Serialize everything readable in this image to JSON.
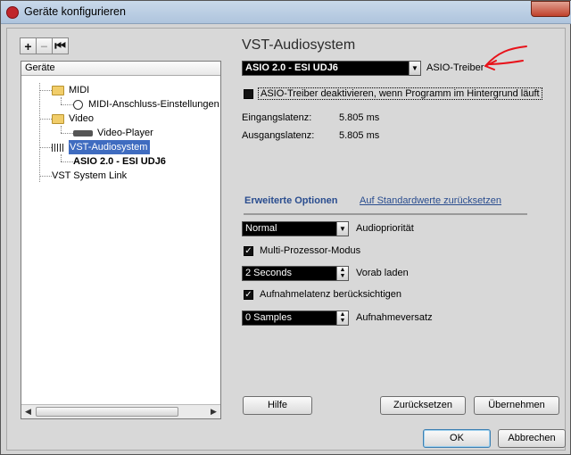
{
  "window": {
    "title": "Geräte konfigurieren"
  },
  "toolbar": {
    "add": "+",
    "remove": "−",
    "reset": "⏮"
  },
  "tree": {
    "header": "Geräte",
    "items": [
      {
        "label": "MIDI"
      },
      {
        "label": "MIDI-Anschluss-Einstellungen"
      },
      {
        "label": "Video"
      },
      {
        "label": "Video-Player"
      },
      {
        "label": "VST-Audiosystem"
      },
      {
        "label": "ASIO 2.0 - ESI UDJ6"
      },
      {
        "label": "VST System Link"
      }
    ]
  },
  "panel": {
    "title": "VST-Audiosystem",
    "driver_value": "ASIO 2.0 - ESI UDJ6",
    "driver_label": "ASIO-Treiber",
    "deactivate_label": "ASIO-Treiber deaktivieren, wenn Programm im Hintergrund läuft",
    "input_latency_label": "Eingangslatenz:",
    "input_latency_value": "5.805 ms",
    "output_latency_label": "Ausgangslatenz:",
    "output_latency_value": "5.805 ms",
    "advanced_label": "Erweiterte Optionen",
    "defaults_link": "Auf Standardwerte zurücksetzen",
    "priority_value": "Normal",
    "priority_label": "Audiopriorität",
    "multiproc_label": "Multi-Prozessor-Modus",
    "preload_value": "2 Seconds",
    "preload_label": "Vorab laden",
    "reclatency_label": "Aufnahmelatenz berücksichtigen",
    "recoffset_value": "0 Samples",
    "recoffset_label": "Aufnahmeversatz"
  },
  "buttons": {
    "help": "Hilfe",
    "reset": "Zurücksetzen",
    "apply": "Übernehmen",
    "ok": "OK",
    "cancel": "Abbrechen"
  },
  "colors": {
    "annotation": "#e8121a",
    "selection": "#3f6cc0"
  }
}
